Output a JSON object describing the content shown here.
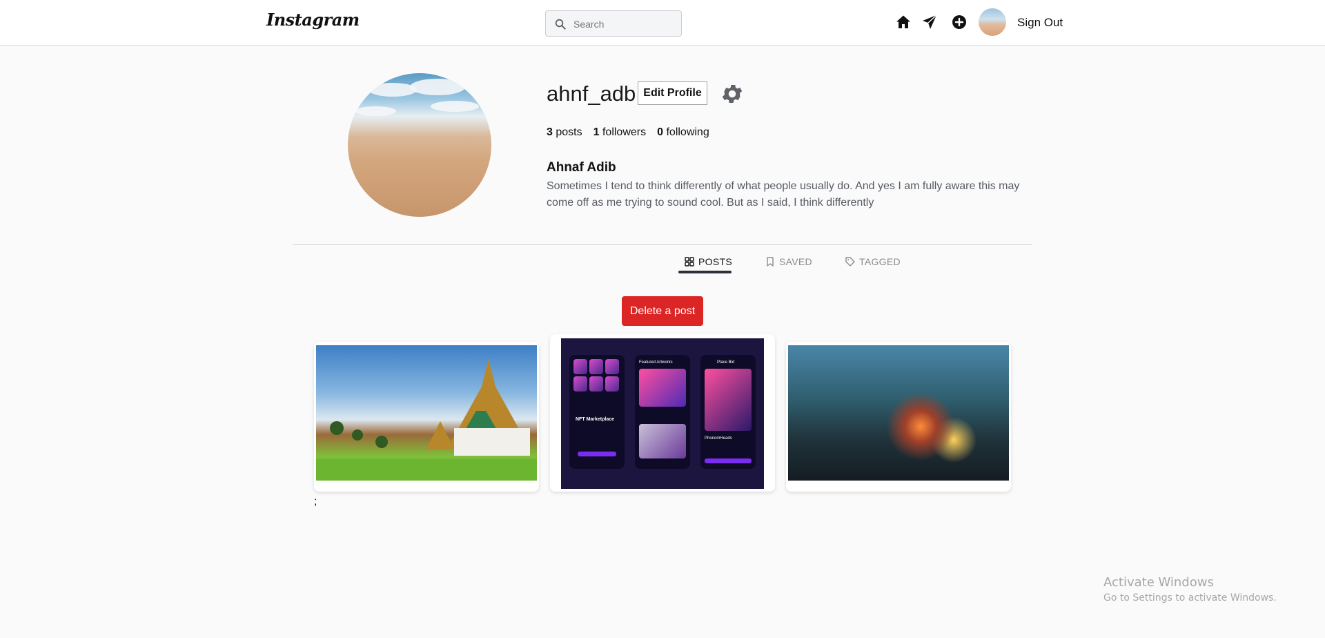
{
  "header": {
    "logo": "Instagram",
    "search_placeholder": "Search",
    "icons": [
      "home-icon",
      "send-icon",
      "add-post-icon"
    ],
    "sign_out": "Sign Out"
  },
  "profile": {
    "username": "ahnf_adb",
    "edit_profile": "Edit Profile",
    "stats": {
      "posts_count": "3",
      "posts_label": "posts",
      "followers_count": "1",
      "followers_label": "followers",
      "following_count": "0",
      "following_label": "following"
    },
    "full_name": "Ahnaf Adib",
    "bio": "Sometimes I tend to think differently of what people usually do. And yes I am fully aware this may come off as me trying to sound cool. But as I said, I think differently"
  },
  "tabs": [
    {
      "label": "POSTS",
      "active": true
    },
    {
      "label": "SAVED",
      "active": false
    },
    {
      "label": "TAGGED",
      "active": false
    }
  ],
  "delete_post": "Delete a post",
  "posts_text": {
    "nft_title": "NFT Marketplace",
    "featured": "Featured Artworks",
    "place_bid": "Place Bid",
    "phantom": "PhonomHeads"
  },
  "stray_text": ";",
  "watermark": {
    "title": "Activate Windows",
    "subtitle": "Go to Settings to activate Windows."
  },
  "colors": {
    "accent_delete": "#dc2626",
    "tab_underline": "#2b2f38"
  }
}
